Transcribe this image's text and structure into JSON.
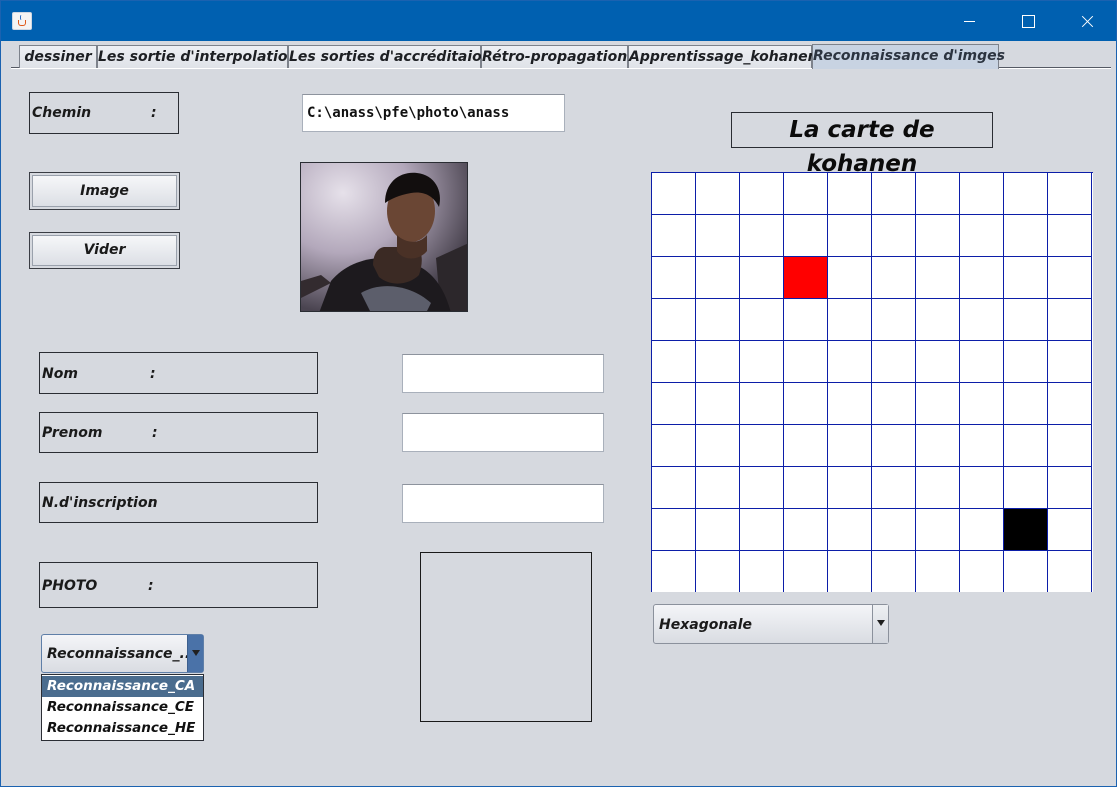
{
  "window": {
    "title": ""
  },
  "tabs": [
    {
      "label": "dessiner"
    },
    {
      "label": "Les sortie d'interpolation"
    },
    {
      "label": "Les sorties d'accréditaion"
    },
    {
      "label": "Rétro-propagation"
    },
    {
      "label": "Apprentissage_kohanen"
    },
    {
      "label": "Reconnaissance d'imges"
    }
  ],
  "active_tab": "Reconnaissance d'imges",
  "form": {
    "chemin_label": "Chemin",
    "colon": ":",
    "chemin_value": "C:\\anass\\pfe\\photo\\anass",
    "image_button": "Image",
    "vider_button": "Vider",
    "nom_label": "Nom",
    "nom_value": "",
    "prenom_label": "Prenom",
    "prenom_value": "",
    "inscription_label": "N.d'inscription",
    "inscription_value": "",
    "photo_label": "PHOTO"
  },
  "recognition_combo": {
    "selected": "Reconnaissance_...",
    "options": [
      "Reconnaissance_CA",
      "Reconnaissance_CE",
      "Reconnaissance_HE"
    ],
    "highlighted_index": 0
  },
  "map": {
    "title": "La carte de kohanen",
    "rows": 10,
    "cols": 10,
    "highlighted_cells": [
      {
        "row": 2,
        "col": 3,
        "color": "#ff0000"
      },
      {
        "row": 8,
        "col": 8,
        "color": "#000000"
      }
    ],
    "grid_color": "#0c1ea8"
  },
  "topology_combo": {
    "selected": "Hexagonale"
  }
}
